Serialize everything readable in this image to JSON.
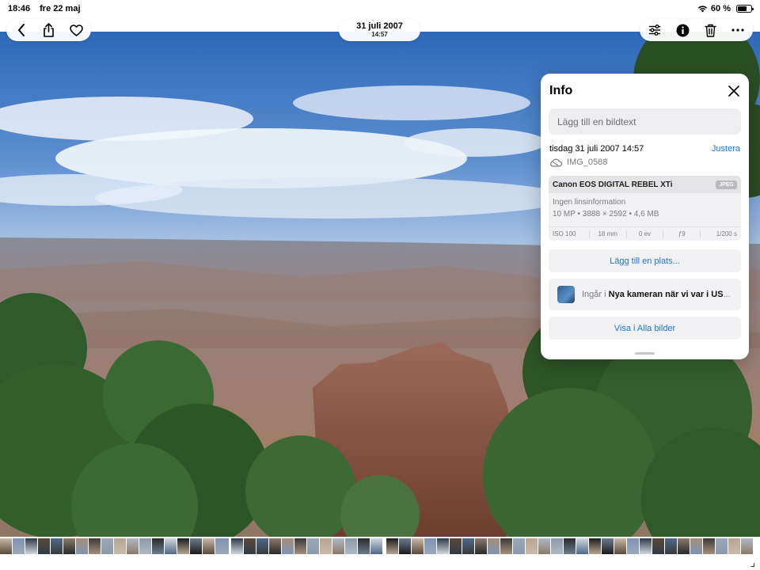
{
  "status_bar": {
    "time": "18:46",
    "date": "fre 22 maj",
    "battery": "60 %",
    "battery_level": 0.6
  },
  "header": {
    "date": "31 juli 2007",
    "time": "14:57"
  },
  "nav_left": {
    "icons": [
      "chevron-left-icon",
      "share-icon",
      "heart-icon"
    ]
  },
  "nav_right": {
    "icons": [
      "sliders-icon",
      "info-icon",
      "trash-icon",
      "more-icon"
    ]
  },
  "info": {
    "title": "Info",
    "caption_placeholder": "Lägg till en bildtext",
    "datetime": "tisdag 31 juli 2007 14:57",
    "adjust": "Justera",
    "filename": "IMG_0588",
    "camera": "Canon EOS DIGITAL REBEL XTi",
    "format": "JPEG",
    "lens": "Ingen linsinformation",
    "specs": "10 MP • 3888 × 2592 • 4,6 MB",
    "exif": {
      "iso": "ISO 100",
      "focal": "18 mm",
      "ev": "0 ev",
      "aperture": "ƒ9",
      "shutter": "1/200 s"
    },
    "add_location": "Lägg till en plats...",
    "album_prefix": "Ingår i ",
    "album_name": "Nya kameran när vi var i US",
    "album_suffix": "...",
    "show_all": "Visa i Alla bilder"
  },
  "colors": {
    "accent": "#1a73e8",
    "sky": "#3f78c2",
    "panel_bg": "#ffffff"
  }
}
